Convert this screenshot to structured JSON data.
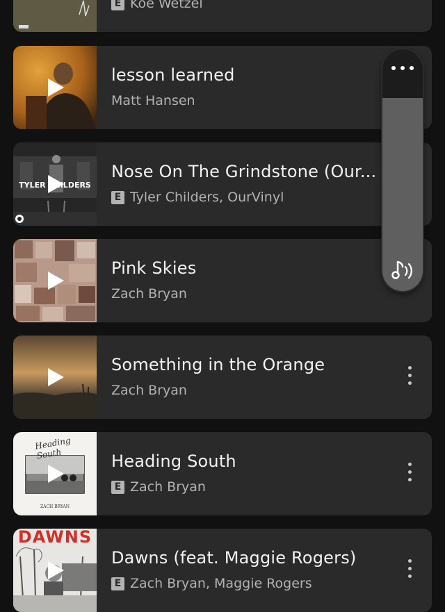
{
  "tracks": [
    {
      "title": "",
      "artist": "Koe Wetzel",
      "explicit": true
    },
    {
      "title": "lesson learned",
      "artist": "Matt Hansen",
      "explicit": false
    },
    {
      "title": "Nose On The Grindstone (Our...",
      "artist": "Tyler Childers, OurVinyl",
      "explicit": true,
      "thumb_text": "TYLER CHILDERS"
    },
    {
      "title": "Pink Skies",
      "artist": "Zach Bryan",
      "explicit": false
    },
    {
      "title": "Something in the Orange",
      "artist": "Zach Bryan",
      "explicit": false
    },
    {
      "title": "Heading South",
      "artist": "Zach Bryan",
      "explicit": true,
      "thumb_text": "ZACH BRYAN",
      "thumb_script": "Heading South"
    },
    {
      "title": "Dawns (feat. Maggie Rogers)",
      "artist": "Zach Bryan, Maggie Rogers",
      "explicit": true,
      "thumb_text": "DAWNS"
    }
  ],
  "explicit_badge": "E",
  "volume_panel": {
    "level": 0.8,
    "icon": "music-note-volume-icon",
    "menu_icon": "more-horizontal-icon"
  },
  "colors": {
    "background": "#111111",
    "card": "#2a2a2a",
    "title": "#f2f2f2",
    "subtitle": "#b3b3b3"
  }
}
